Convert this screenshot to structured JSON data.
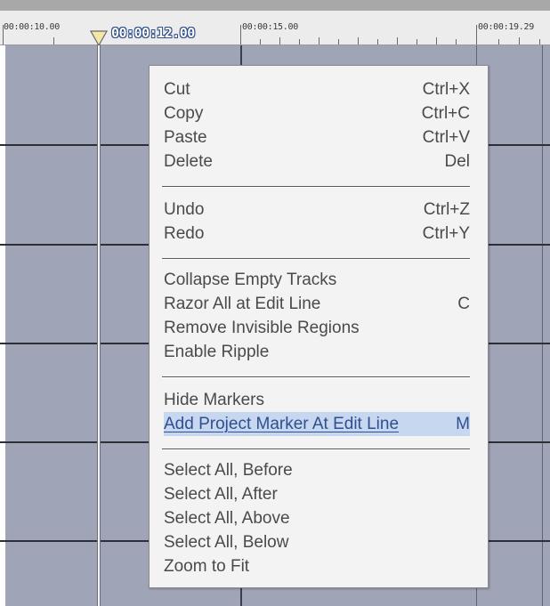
{
  "ruler": {
    "timecodes": [
      "00:00:10.00",
      "00:00:15.00",
      "00:00:19.29"
    ],
    "current_time": "00:00:12.00"
  },
  "context_menu": {
    "groups": [
      [
        {
          "label": "Cut",
          "shortcut": "Ctrl+X"
        },
        {
          "label": "Copy",
          "shortcut": "Ctrl+C"
        },
        {
          "label": "Paste",
          "shortcut": "Ctrl+V"
        },
        {
          "label": "Delete",
          "shortcut": "Del"
        }
      ],
      [
        {
          "label": "Undo",
          "shortcut": "Ctrl+Z"
        },
        {
          "label": "Redo",
          "shortcut": "Ctrl+Y"
        }
      ],
      [
        {
          "label": "Collapse Empty Tracks",
          "shortcut": ""
        },
        {
          "label": "Razor All at Edit Line",
          "shortcut": "C"
        },
        {
          "label": "Remove Invisible Regions",
          "shortcut": ""
        },
        {
          "label": "Enable Ripple",
          "shortcut": ""
        }
      ],
      [
        {
          "label": "Hide Markers",
          "shortcut": ""
        },
        {
          "label": "Add Project Marker At Edit Line",
          "shortcut": "M"
        }
      ],
      [
        {
          "label": "Select All, Before",
          "shortcut": ""
        },
        {
          "label": "Select All, After",
          "shortcut": ""
        },
        {
          "label": "Select All, Above",
          "shortcut": ""
        },
        {
          "label": "Select All, Below",
          "shortcut": ""
        },
        {
          "label": "Zoom to Fit",
          "shortcut": ""
        }
      ]
    ],
    "highlighted_item": "Add Project Marker At Edit Line"
  },
  "colors": {
    "track_background": "#9fa4b6",
    "menu_background": "#f3f3f3",
    "highlight": "#c8d7f0",
    "playhead_marker": "#f2e7a6"
  }
}
